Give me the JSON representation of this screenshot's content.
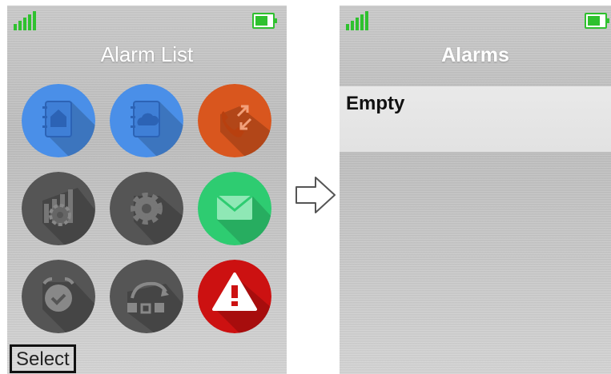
{
  "left_screen": {
    "title": "Alarm List",
    "softkey_label": "Select",
    "apps": [
      {
        "icon": "contacts-home-icon",
        "color": "#4a8fe8"
      },
      {
        "icon": "contacts-cloud-icon",
        "color": "#4a8fe8"
      },
      {
        "icon": "call-transfer-icon",
        "color": "#d9561e"
      },
      {
        "icon": "signal-settings-icon",
        "color": "#555555"
      },
      {
        "icon": "gear-icon",
        "color": "#555555"
      },
      {
        "icon": "envelope-icon",
        "color": "#2ecc71"
      },
      {
        "icon": "alarm-clock-icon",
        "color": "#555555"
      },
      {
        "icon": "sync-icon",
        "color": "#555555"
      },
      {
        "icon": "warning-icon",
        "color": "#cc1111"
      }
    ]
  },
  "right_screen": {
    "title": "Alarms",
    "list_items": [
      "Empty"
    ]
  },
  "colors": {
    "status_green": "#2fc12f",
    "title_text": "#ffffff"
  }
}
